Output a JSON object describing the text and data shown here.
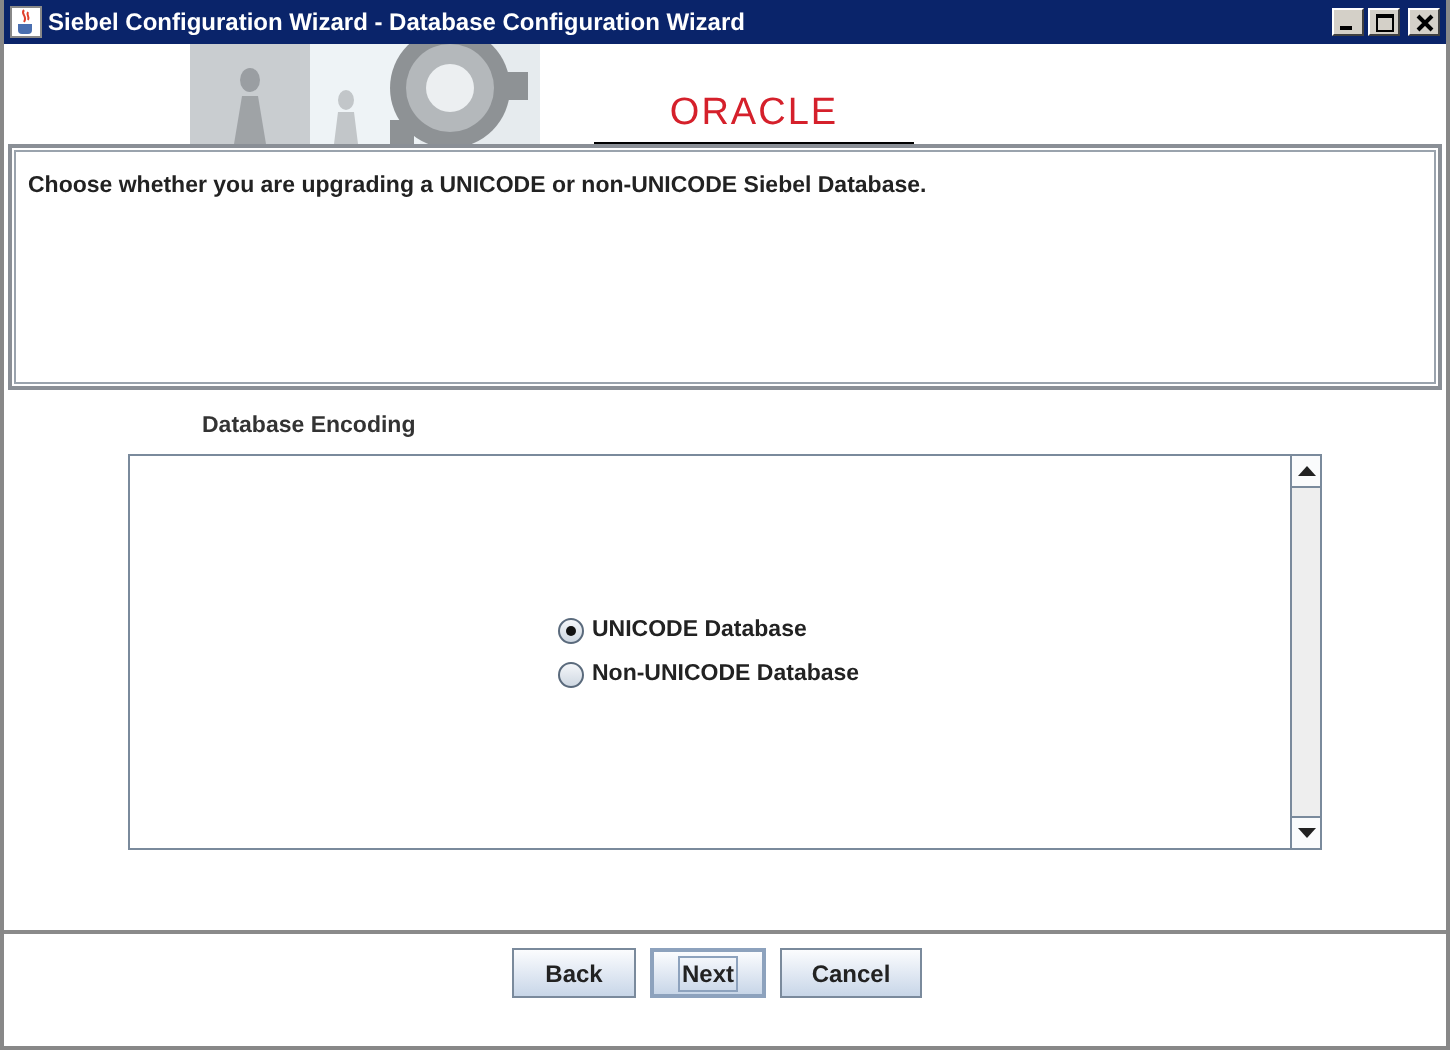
{
  "window": {
    "title": "Siebel Configuration Wizard - Database Configuration Wizard"
  },
  "banner": {
    "logo": "ORACLE"
  },
  "description": "Choose whether you are upgrading a UNICODE or non-UNICODE Siebel Database.",
  "section": {
    "label": "Database Encoding",
    "options": [
      {
        "label": "UNICODE Database",
        "selected": true
      },
      {
        "label": "Non-UNICODE Database",
        "selected": false
      }
    ]
  },
  "buttons": [
    {
      "label": "Back",
      "focused": false
    },
    {
      "label": "Next",
      "focused": true
    },
    {
      "label": "Cancel",
      "focused": false
    }
  ]
}
